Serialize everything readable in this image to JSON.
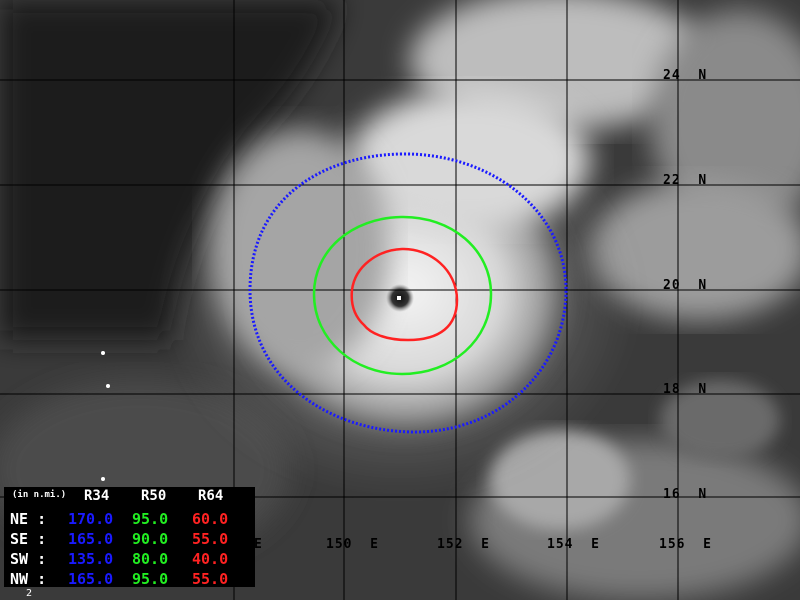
{
  "map": {
    "latitude_labels": [
      "24",
      "22",
      "20",
      "18",
      "16"
    ],
    "latitude_hemisphere": "N",
    "longitude_labels": [
      "150",
      "152",
      "154",
      "156"
    ],
    "longitude_hemisphere": "E",
    "partial_longitude_label": "E",
    "storm_center": {
      "lat": 19.8,
      "lon": 151.05
    },
    "colors": {
      "r34": "#1a1aff",
      "r50": "#22ee22",
      "r64": "#ff2222",
      "grid": "#000000",
      "eye_marker": "#ffffff"
    }
  },
  "legend": {
    "unit_label": "(in n.mi.)",
    "headers": [
      "R34",
      "R50",
      "R64"
    ],
    "rows": [
      {
        "quadrant": "NE :",
        "r34": "170.0",
        "r50": "95.0",
        "r64": "60.0"
      },
      {
        "quadrant": "SE :",
        "r34": "165.0",
        "r50": "90.0",
        "r64": "55.0"
      },
      {
        "quadrant": "SW :",
        "r34": "135.0",
        "r50": "80.0",
        "r64": "40.0"
      },
      {
        "quadrant": "NW :",
        "r34": "165.0",
        "r50": "95.0",
        "r64": "55.0"
      }
    ]
  },
  "frame_number": "2"
}
